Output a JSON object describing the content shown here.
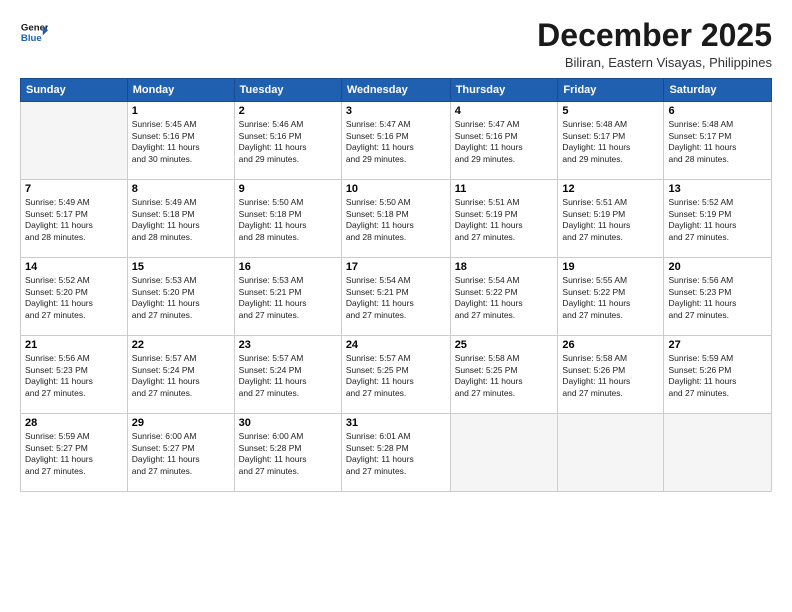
{
  "header": {
    "logo_line1": "General",
    "logo_line2": "Blue",
    "month": "December 2025",
    "location": "Biliran, Eastern Visayas, Philippines"
  },
  "weekdays": [
    "Sunday",
    "Monday",
    "Tuesday",
    "Wednesday",
    "Thursday",
    "Friday",
    "Saturday"
  ],
  "weeks": [
    [
      {
        "num": "",
        "info": ""
      },
      {
        "num": "1",
        "info": "Sunrise: 5:45 AM\nSunset: 5:16 PM\nDaylight: 11 hours\nand 30 minutes."
      },
      {
        "num": "2",
        "info": "Sunrise: 5:46 AM\nSunset: 5:16 PM\nDaylight: 11 hours\nand 29 minutes."
      },
      {
        "num": "3",
        "info": "Sunrise: 5:47 AM\nSunset: 5:16 PM\nDaylight: 11 hours\nand 29 minutes."
      },
      {
        "num": "4",
        "info": "Sunrise: 5:47 AM\nSunset: 5:16 PM\nDaylight: 11 hours\nand 29 minutes."
      },
      {
        "num": "5",
        "info": "Sunrise: 5:48 AM\nSunset: 5:17 PM\nDaylight: 11 hours\nand 29 minutes."
      },
      {
        "num": "6",
        "info": "Sunrise: 5:48 AM\nSunset: 5:17 PM\nDaylight: 11 hours\nand 28 minutes."
      }
    ],
    [
      {
        "num": "7",
        "info": "Sunrise: 5:49 AM\nSunset: 5:17 PM\nDaylight: 11 hours\nand 28 minutes."
      },
      {
        "num": "8",
        "info": "Sunrise: 5:49 AM\nSunset: 5:18 PM\nDaylight: 11 hours\nand 28 minutes."
      },
      {
        "num": "9",
        "info": "Sunrise: 5:50 AM\nSunset: 5:18 PM\nDaylight: 11 hours\nand 28 minutes."
      },
      {
        "num": "10",
        "info": "Sunrise: 5:50 AM\nSunset: 5:18 PM\nDaylight: 11 hours\nand 28 minutes."
      },
      {
        "num": "11",
        "info": "Sunrise: 5:51 AM\nSunset: 5:19 PM\nDaylight: 11 hours\nand 27 minutes."
      },
      {
        "num": "12",
        "info": "Sunrise: 5:51 AM\nSunset: 5:19 PM\nDaylight: 11 hours\nand 27 minutes."
      },
      {
        "num": "13",
        "info": "Sunrise: 5:52 AM\nSunset: 5:19 PM\nDaylight: 11 hours\nand 27 minutes."
      }
    ],
    [
      {
        "num": "14",
        "info": "Sunrise: 5:52 AM\nSunset: 5:20 PM\nDaylight: 11 hours\nand 27 minutes."
      },
      {
        "num": "15",
        "info": "Sunrise: 5:53 AM\nSunset: 5:20 PM\nDaylight: 11 hours\nand 27 minutes."
      },
      {
        "num": "16",
        "info": "Sunrise: 5:53 AM\nSunset: 5:21 PM\nDaylight: 11 hours\nand 27 minutes."
      },
      {
        "num": "17",
        "info": "Sunrise: 5:54 AM\nSunset: 5:21 PM\nDaylight: 11 hours\nand 27 minutes."
      },
      {
        "num": "18",
        "info": "Sunrise: 5:54 AM\nSunset: 5:22 PM\nDaylight: 11 hours\nand 27 minutes."
      },
      {
        "num": "19",
        "info": "Sunrise: 5:55 AM\nSunset: 5:22 PM\nDaylight: 11 hours\nand 27 minutes."
      },
      {
        "num": "20",
        "info": "Sunrise: 5:56 AM\nSunset: 5:23 PM\nDaylight: 11 hours\nand 27 minutes."
      }
    ],
    [
      {
        "num": "21",
        "info": "Sunrise: 5:56 AM\nSunset: 5:23 PM\nDaylight: 11 hours\nand 27 minutes."
      },
      {
        "num": "22",
        "info": "Sunrise: 5:57 AM\nSunset: 5:24 PM\nDaylight: 11 hours\nand 27 minutes."
      },
      {
        "num": "23",
        "info": "Sunrise: 5:57 AM\nSunset: 5:24 PM\nDaylight: 11 hours\nand 27 minutes."
      },
      {
        "num": "24",
        "info": "Sunrise: 5:57 AM\nSunset: 5:25 PM\nDaylight: 11 hours\nand 27 minutes."
      },
      {
        "num": "25",
        "info": "Sunrise: 5:58 AM\nSunset: 5:25 PM\nDaylight: 11 hours\nand 27 minutes."
      },
      {
        "num": "26",
        "info": "Sunrise: 5:58 AM\nSunset: 5:26 PM\nDaylight: 11 hours\nand 27 minutes."
      },
      {
        "num": "27",
        "info": "Sunrise: 5:59 AM\nSunset: 5:26 PM\nDaylight: 11 hours\nand 27 minutes."
      }
    ],
    [
      {
        "num": "28",
        "info": "Sunrise: 5:59 AM\nSunset: 5:27 PM\nDaylight: 11 hours\nand 27 minutes."
      },
      {
        "num": "29",
        "info": "Sunrise: 6:00 AM\nSunset: 5:27 PM\nDaylight: 11 hours\nand 27 minutes."
      },
      {
        "num": "30",
        "info": "Sunrise: 6:00 AM\nSunset: 5:28 PM\nDaylight: 11 hours\nand 27 minutes."
      },
      {
        "num": "31",
        "info": "Sunrise: 6:01 AM\nSunset: 5:28 PM\nDaylight: 11 hours\nand 27 minutes."
      },
      {
        "num": "",
        "info": ""
      },
      {
        "num": "",
        "info": ""
      },
      {
        "num": "",
        "info": ""
      }
    ]
  ]
}
